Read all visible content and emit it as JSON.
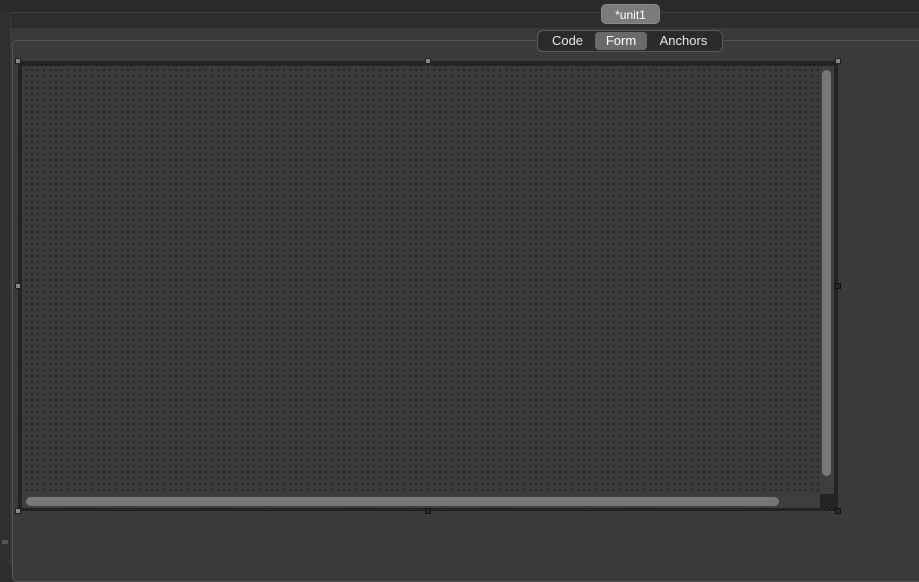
{
  "window": {
    "unit_tab": "*unit1"
  },
  "view_switch": {
    "items": [
      {
        "label": "Code",
        "selected": false
      },
      {
        "label": "Form",
        "selected": true
      },
      {
        "label": "Anchors",
        "selected": false
      }
    ]
  },
  "designer": {
    "horizontal_scroll_fraction": 0.0,
    "vertical_scroll_fraction": 0.0
  }
}
